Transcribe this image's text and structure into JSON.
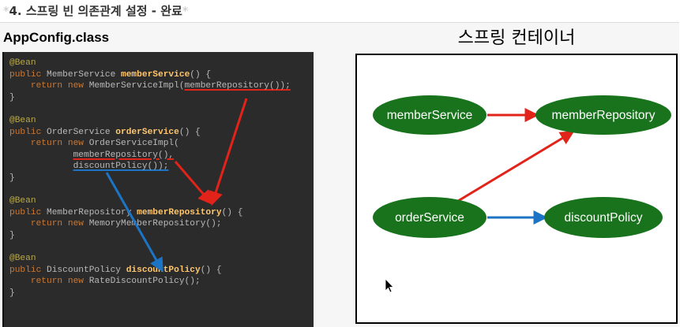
{
  "heading": {
    "number": "4.",
    "text": "스프링 빈 의존관계 설정 - 완료"
  },
  "file_title": "AppConfig.class",
  "container_title": "스프링 컨테이너",
  "code_lines": [
    [
      {
        "t": "@Bean",
        "c": "ann"
      }
    ],
    [
      {
        "t": "public ",
        "c": "kw"
      },
      {
        "t": "MemberService "
      },
      {
        "t": "memberService",
        "c": "meth"
      },
      {
        "t": "() {"
      }
    ],
    [
      {
        "t": "    return ",
        "c": "kw"
      },
      {
        "t": "new ",
        "c": "kw"
      },
      {
        "t": "MemberServiceImpl("
      },
      {
        "t": "memberRepository());",
        "c": "ul-red"
      }
    ],
    [
      {
        "t": "}"
      }
    ],
    [
      {
        "t": ""
      }
    ],
    [
      {
        "t": "@Bean",
        "c": "ann"
      }
    ],
    [
      {
        "t": "public ",
        "c": "kw"
      },
      {
        "t": "OrderService "
      },
      {
        "t": "orderService",
        "c": "meth"
      },
      {
        "t": "() {"
      }
    ],
    [
      {
        "t": "    return ",
        "c": "kw"
      },
      {
        "t": "new ",
        "c": "kw"
      },
      {
        "t": "OrderServiceImpl("
      }
    ],
    [
      {
        "t": "            "
      },
      {
        "t": "memberRepository(),",
        "c": "ul-red"
      }
    ],
    [
      {
        "t": "            "
      },
      {
        "t": "discountPolicy());",
        "c": "ul-blue"
      }
    ],
    [
      {
        "t": "}"
      }
    ],
    [
      {
        "t": ""
      }
    ],
    [
      {
        "t": "@Bean",
        "c": "ann"
      }
    ],
    [
      {
        "t": "public ",
        "c": "kw"
      },
      {
        "t": "MemberRepository "
      },
      {
        "t": "memberRepository",
        "c": "meth"
      },
      {
        "t": "() {"
      }
    ],
    [
      {
        "t": "    return ",
        "c": "kw"
      },
      {
        "t": "new ",
        "c": "kw"
      },
      {
        "t": "MemoryMemberRepository();"
      }
    ],
    [
      {
        "t": "}"
      }
    ],
    [
      {
        "t": ""
      }
    ],
    [
      {
        "t": "@Bean",
        "c": "ann"
      }
    ],
    [
      {
        "t": "public ",
        "c": "kw"
      },
      {
        "t": "DiscountPolicy "
      },
      {
        "t": "discountPolicy",
        "c": "meth"
      },
      {
        "t": "() {"
      }
    ],
    [
      {
        "t": "    return ",
        "c": "kw"
      },
      {
        "t": "new ",
        "c": "kw"
      },
      {
        "t": "RateDiscountPolicy();"
      }
    ],
    [
      {
        "t": "}"
      }
    ]
  ],
  "beans": [
    {
      "id": "member-service",
      "label": "memberService"
    },
    {
      "id": "member-repository",
      "label": "memberRepository"
    },
    {
      "id": "order-service",
      "label": "orderService"
    },
    {
      "id": "discount-policy",
      "label": "discountPolicy"
    }
  ],
  "dependencies": [
    {
      "from": "member-service",
      "to": "member-repository",
      "color": "red"
    },
    {
      "from": "order-service",
      "to": "member-repository",
      "color": "red"
    },
    {
      "from": "order-service",
      "to": "discount-policy",
      "color": "blue"
    }
  ],
  "colors": {
    "bean_fill": "#18731c",
    "red_arrow": "#e2231a",
    "blue_arrow": "#1e74c4",
    "code_bg": "#2b2b2b",
    "method_name": "#ffc66d",
    "keyword": "#cc7832",
    "annotation": "#b8a94a"
  }
}
